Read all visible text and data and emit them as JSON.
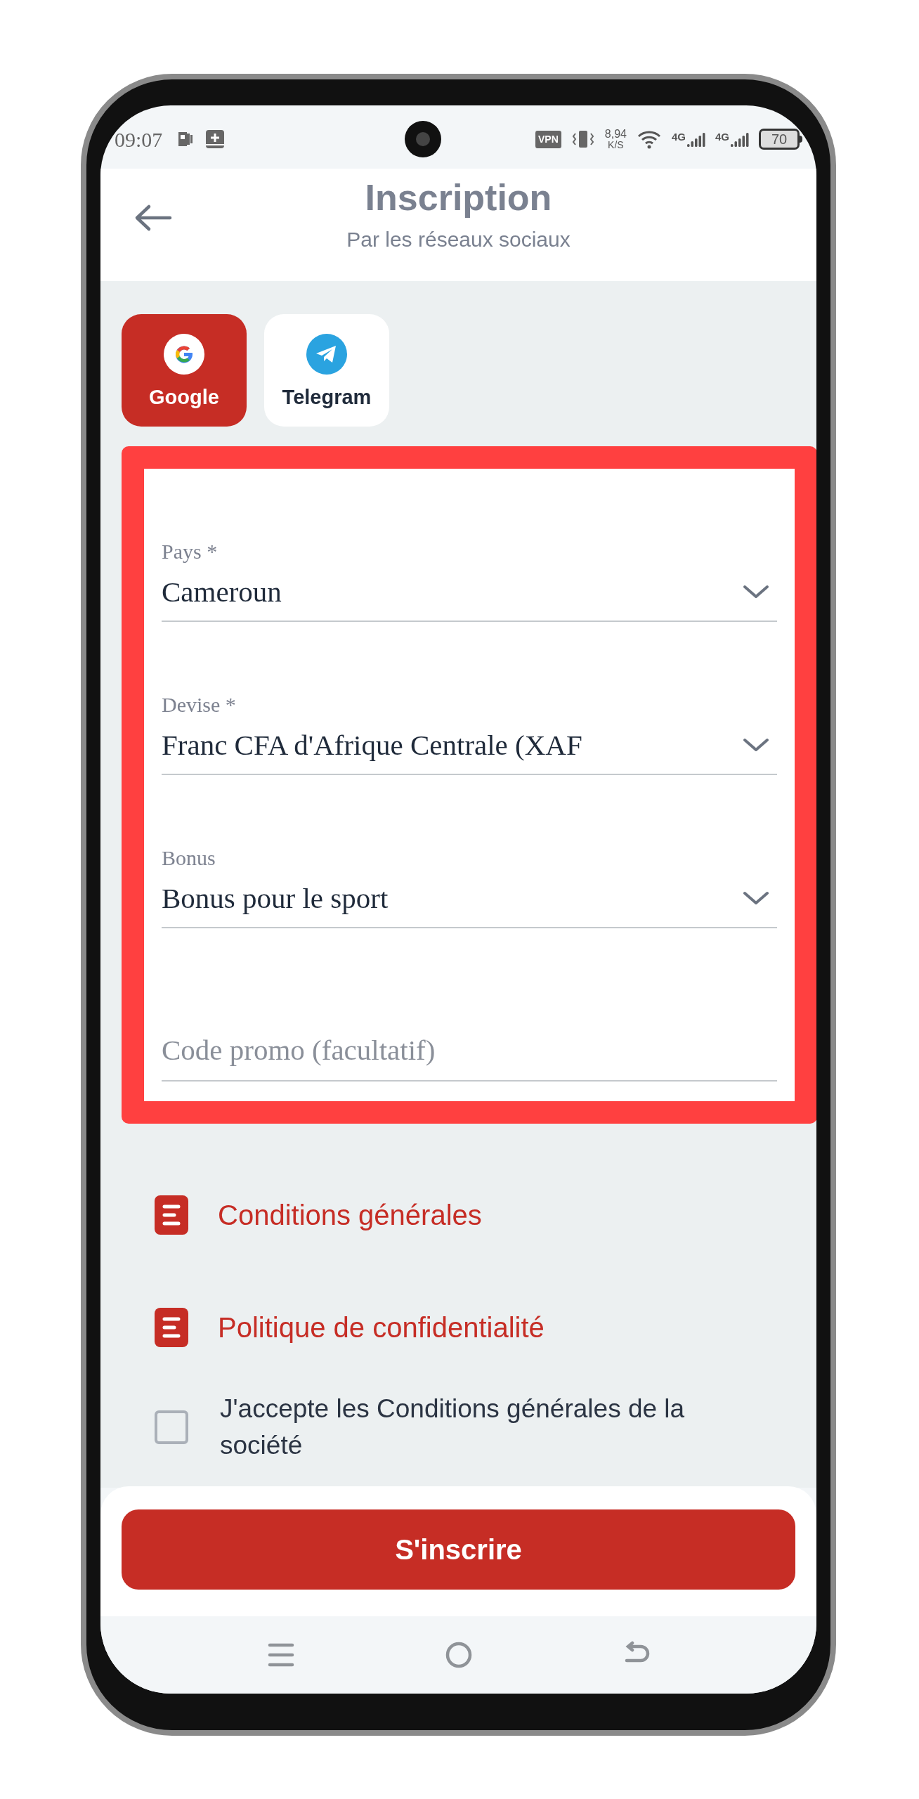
{
  "status_bar": {
    "time": "09:07",
    "vpn": "VPN",
    "speed": "8,94",
    "speed_unit": "K/S",
    "networks": [
      "4G",
      "4G"
    ],
    "battery": "70"
  },
  "header": {
    "title": "Inscription",
    "subtitle": "Par les réseaux sociaux"
  },
  "social": [
    {
      "kind": "google",
      "label": "Google",
      "selected": true
    },
    {
      "kind": "telegram",
      "label": "Telegram",
      "selected": false
    }
  ],
  "form": {
    "fields": [
      {
        "kind": "select",
        "label": "Pays *",
        "value": "Cameroun"
      },
      {
        "kind": "select",
        "label": "Devise *",
        "value": "Franc CFA d'Afrique Centrale (XAF"
      },
      {
        "kind": "select",
        "label": "Bonus",
        "value": "Bonus pour le sport"
      },
      {
        "kind": "text",
        "placeholder": "Code promo (facultatif)"
      }
    ]
  },
  "links": [
    "Conditions générales",
    "Politique de confidentialité"
  ],
  "agreements": [
    {
      "label": "J'accepte les Conditions générales de la société",
      "checked": false
    }
  ],
  "submit": "S'inscrire"
}
